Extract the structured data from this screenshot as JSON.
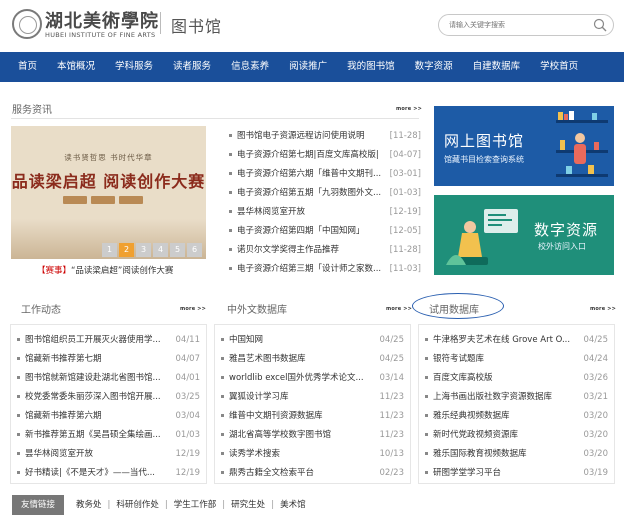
{
  "header": {
    "logo_cn": "湖北美術學院",
    "logo_en": "HUBEI INSTITUTE OF FINE ARTS",
    "site_title": "图书馆",
    "search_placeholder": "请输入关键字搜索"
  },
  "nav": [
    "首页",
    "本馆概况",
    "学科服务",
    "读者服务",
    "信息素养",
    "阅读推广",
    "我的图书馆",
    "数字资源",
    "自建数据库",
    "学校首页"
  ],
  "service": {
    "title": "服务资讯",
    "more": "more >>",
    "banner": {
      "line1": "读书贤哲思  书时代华章",
      "line2": "品读梁启超  阅读创作大赛",
      "pages": [
        "1",
        "2",
        "3",
        "4",
        "5",
        "6"
      ],
      "active_page": "2",
      "caption_tag": "【赛事】",
      "caption_text": "“品读梁启超”阅读创作大赛"
    },
    "items": [
      {
        "title": "图书馆电子资源远程访问使用说明",
        "date": "[11-28]"
      },
      {
        "title": "电子资源介绍第七期|百度文库高校版|",
        "date": "[04-07]"
      },
      {
        "title": "电子资源介绍第六期「维普中文期刊...",
        "date": "[03-01]"
      },
      {
        "title": "电子资源介绍第五期「九羽数图外文...",
        "date": "[01-03]"
      },
      {
        "title": "昙华林阅览室开放",
        "date": "[12-19]"
      },
      {
        "title": "电子资源介绍第四期「中国知网」",
        "date": "[12-05]"
      },
      {
        "title": "诺贝尔文学奖得主作品推荐",
        "date": "[11-28]"
      },
      {
        "title": "电子资源介绍第三期「设计师之家数...",
        "date": "[11-03]"
      }
    ]
  },
  "promos": [
    {
      "title": "网上图书馆",
      "subtitle": "馆藏书目检索查询系统"
    },
    {
      "title": "数字资源",
      "subtitle": "校外访问入口"
    }
  ],
  "work": {
    "title": "工作动态",
    "more": "more >>",
    "items": [
      {
        "title": "图书馆组织员工开展灭火器使用学...",
        "date": "04/11"
      },
      {
        "title": "馆藏新书推荐第七期",
        "date": "04/07"
      },
      {
        "title": "图书馆就新馆建设赴湖北省图书馆...",
        "date": "04/01"
      },
      {
        "title": "校党委常委朱丽莎深入图书馆开展...",
        "date": "03/25"
      },
      {
        "title": "馆藏新书推荐第六期",
        "date": "03/04"
      },
      {
        "title": "新书推荐第五期《吴昌硕全集绘画...",
        "date": "01/03"
      },
      {
        "title": "昙华林阅览室开放",
        "date": "12/19"
      },
      {
        "title": "好书精读|《不是天才》——当代...",
        "date": "12/19"
      }
    ]
  },
  "cn_db": {
    "title": "中外文数据库",
    "more": "more >>",
    "items": [
      {
        "title": "中国知网",
        "date": "04/25"
      },
      {
        "title": "雅昌艺术图书数据库",
        "date": "04/25"
      },
      {
        "title": "worldlib excel国外优秀学术论文...",
        "date": "03/14"
      },
      {
        "title": "翼狐设计学习库",
        "date": "11/23"
      },
      {
        "title": "维普中文期刊资源数据库",
        "date": "11/23"
      },
      {
        "title": "湖北省高等学校数字图书馆",
        "date": "11/23"
      },
      {
        "title": "读秀学术搜索",
        "date": "10/13"
      },
      {
        "title": "鼎秀古籍全文检索平台",
        "date": "02/23"
      }
    ]
  },
  "trial_db": {
    "title": "试用数据库",
    "more": "more >>",
    "items": [
      {
        "title": "牛津格罗夫艺术在线 Grove Art O...",
        "date": "04/25"
      },
      {
        "title": "银符考试题库",
        "date": "04/24"
      },
      {
        "title": "百度文库高校版",
        "date": "03/26"
      },
      {
        "title": "上海书画出版社数字资源数据库",
        "date": "03/21"
      },
      {
        "title": "雅乐经典视频数据库",
        "date": "03/20"
      },
      {
        "title": "新时代党政视频资源库",
        "date": "03/20"
      },
      {
        "title": "雅乐国际教育视频数据库",
        "date": "03/20"
      },
      {
        "title": "研图学堂学习平台",
        "date": "03/19"
      }
    ]
  },
  "footer": {
    "label": "友情链接",
    "links": [
      "教务处",
      "科研创作处",
      "学生工作部",
      "研究生处",
      "美术馆"
    ]
  }
}
